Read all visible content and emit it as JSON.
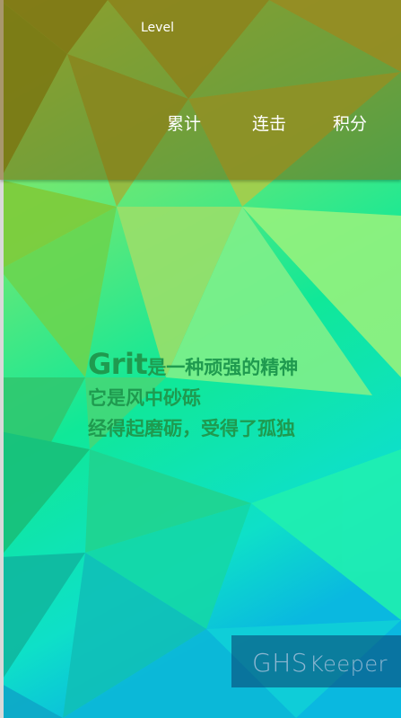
{
  "header": {
    "level_label": "Level",
    "stats": {
      "total_label": "累计",
      "streak_label": "连击",
      "points_label": "积分"
    }
  },
  "quote": {
    "lead": "Grit",
    "line1_rest": "是一种顽强的精神",
    "line2": "它是风中砂砾",
    "line3": "经得起磨砺，受得了孤独"
  },
  "brand": {
    "part1": "GHS",
    "part2": "Keeper"
  },
  "colors": {
    "header_overlay": "#7a5a00",
    "quote_text": "#1f9a4f",
    "brand_text": "#8fb7d2"
  }
}
